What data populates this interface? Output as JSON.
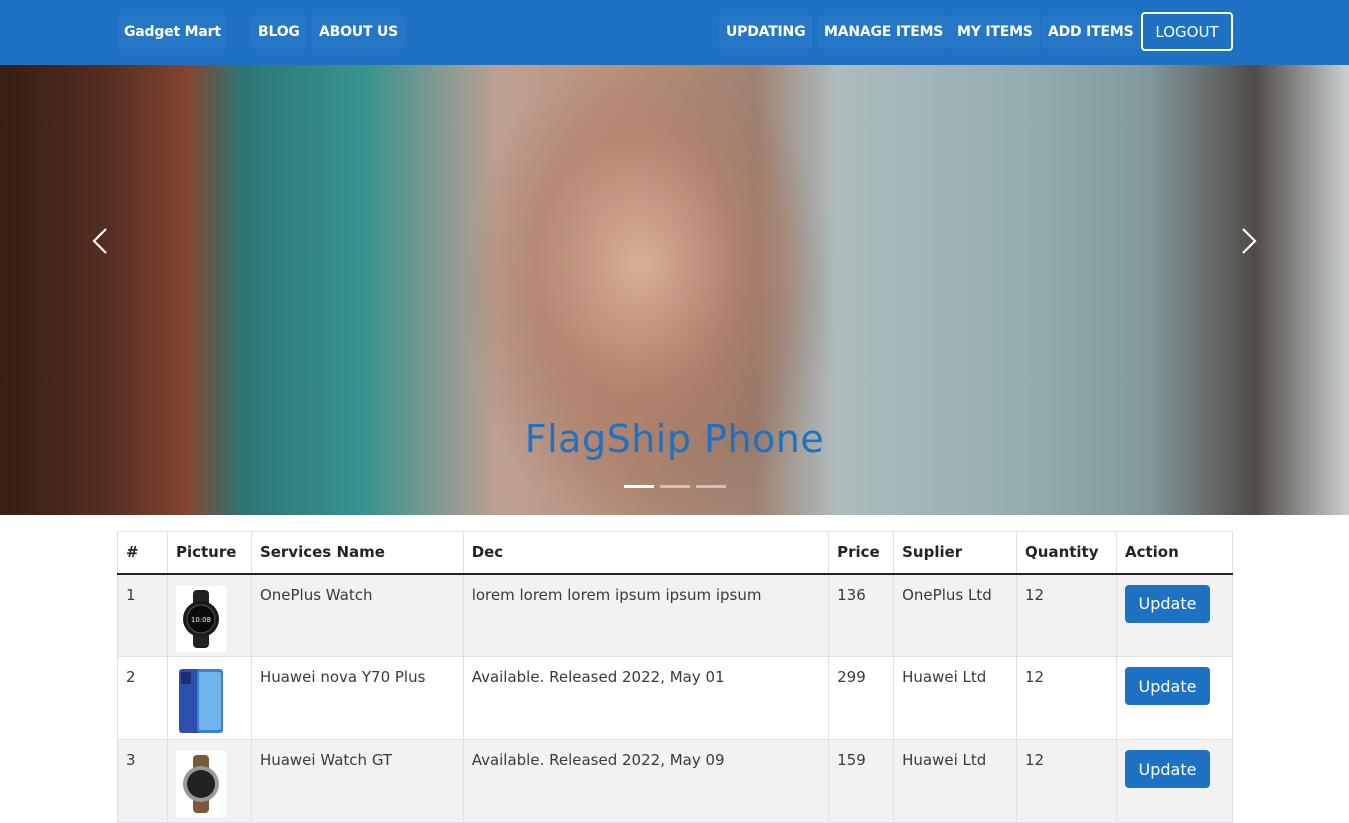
{
  "navbar": {
    "brand": "Gadget Mart",
    "left_links": [
      "BLOG",
      "ABOUT US"
    ],
    "right_links": [
      "UPDATING",
      "MANAGE ITEMS",
      "MY ITEMS",
      "ADD ITEMS"
    ],
    "logout": "LOGOUT",
    "background_color": "#1e72c4"
  },
  "hero": {
    "caption": "FlagShip Phone",
    "caption_color": "#1e72c4",
    "prev_icon": "chevron-left-icon",
    "next_icon": "chevron-right-icon",
    "slide_count": 3,
    "active_slide": 1
  },
  "table": {
    "headers": [
      "#",
      "Picture",
      "Services Name",
      "Dec",
      "Price",
      "Suplier",
      "Quantity",
      "Action"
    ],
    "rows": [
      {
        "num": "1",
        "picture": "smartwatch-image",
        "name": "OnePlus Watch",
        "dec": "lorem lorem lorem ipsum ipsum ipsum",
        "price": "136",
        "supplier": "OnePlus Ltd",
        "quantity": "12",
        "action": "Update"
      },
      {
        "num": "2",
        "picture": "smartphone-image",
        "name": "Huawei nova Y70 Plus",
        "dec": "Available. Released 2022, May 01",
        "price": "299",
        "supplier": "Huawei Ltd",
        "quantity": "12",
        "action": "Update"
      },
      {
        "num": "3",
        "picture": "smartwatch-image",
        "name": "Huawei Watch GT",
        "dec": "Available. Released 2022, May 09",
        "price": "159",
        "supplier": "Huawei Ltd",
        "quantity": "12",
        "action": "Update"
      }
    ]
  }
}
